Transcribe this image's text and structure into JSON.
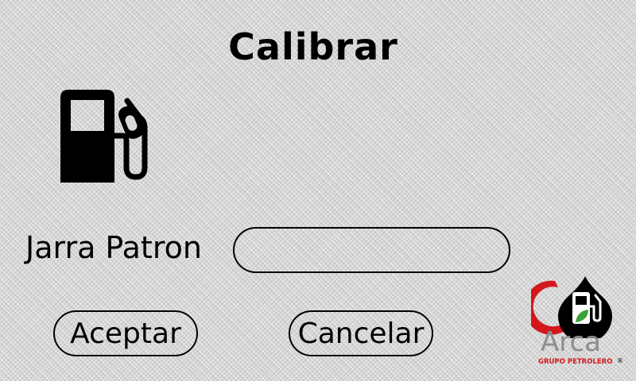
{
  "screen": {
    "title": "Calibrar"
  },
  "form": {
    "field_label": "Jarra Patron",
    "field_value": "",
    "field_placeholder": ""
  },
  "buttons": {
    "accept_label": "Aceptar",
    "cancel_label": "Cancelar"
  },
  "icons": {
    "main_icon": "fuel-pump-icon",
    "logo_icon": "fuel-pump-leaf-icon"
  },
  "logo": {
    "name": "Arca",
    "tagline": "GRUPO PETROLERO",
    "registered_mark": "®"
  },
  "colors": {
    "text": "#000000",
    "brand_red": "#d4161d",
    "brand_gray": "#8d8d8d",
    "brand_green": "#3aa13a"
  }
}
